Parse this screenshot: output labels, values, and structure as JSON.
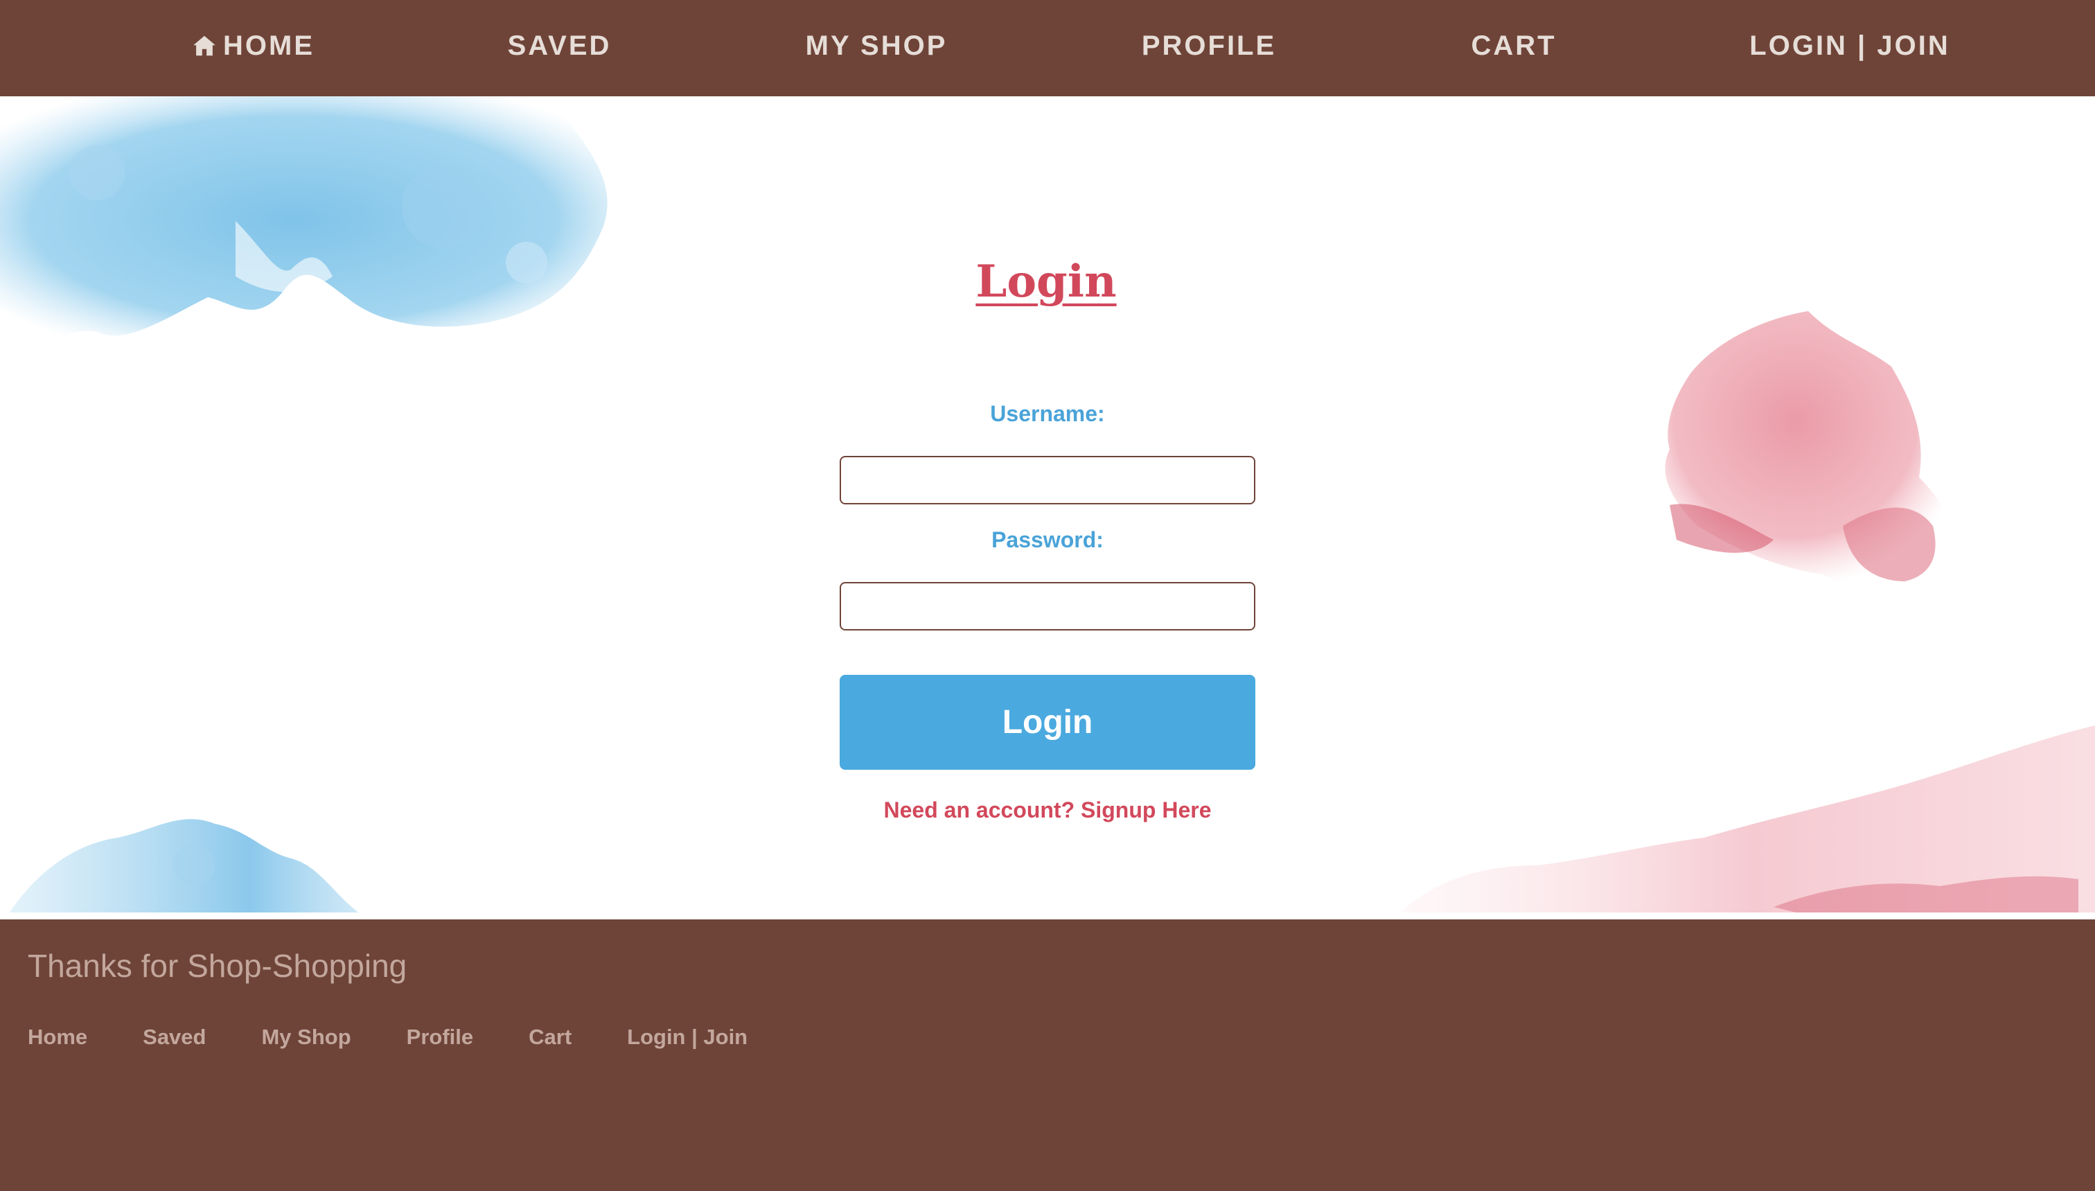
{
  "nav": {
    "home_label": "HOME",
    "saved_label": "SAVED",
    "myshop_label": "MY SHOP",
    "profile_label": "PROFILE",
    "cart_label": "CART",
    "login_label": "LOGIN | JOIN",
    "home_icon": "house-icon"
  },
  "login_form": {
    "title": "Login",
    "username_label": "Username:",
    "username_value": "",
    "password_label": "Password:",
    "password_value": "",
    "submit_label": "Login",
    "signup_link": "Need an account? Signup Here"
  },
  "footer": {
    "tagline": "Thanks for Shop-Shopping",
    "links": [
      "Home",
      "Saved",
      "My Shop",
      "Profile",
      "Cart",
      "Login | Join"
    ]
  },
  "colors": {
    "nav_background": "#6f4438",
    "accent_red": "#d2485b",
    "accent_blue": "#4aa9df",
    "nav_text": "#e6ddd7"
  }
}
